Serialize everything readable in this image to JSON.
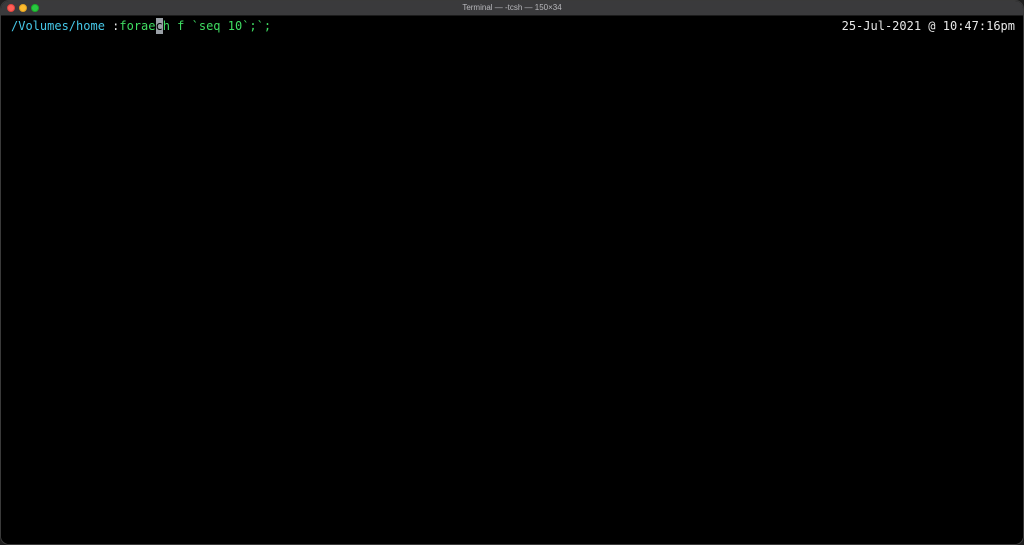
{
  "window": {
    "title": "Terminal — -tcsh — 150×34"
  },
  "prompt": {
    "cwd": "/Volumes/home",
    "separator": " :",
    "command_before_cursor": "forae",
    "cursor_char": "c",
    "command_after_cursor": "h f `seq 10`;`;"
  },
  "status": {
    "datetime": "25-Jul-2021 @ 10:47:16pm"
  },
  "colors": {
    "background": "#000000",
    "cwd": "#46c8e8",
    "command": "#3fdc62",
    "clock": "#e8e8e8"
  }
}
